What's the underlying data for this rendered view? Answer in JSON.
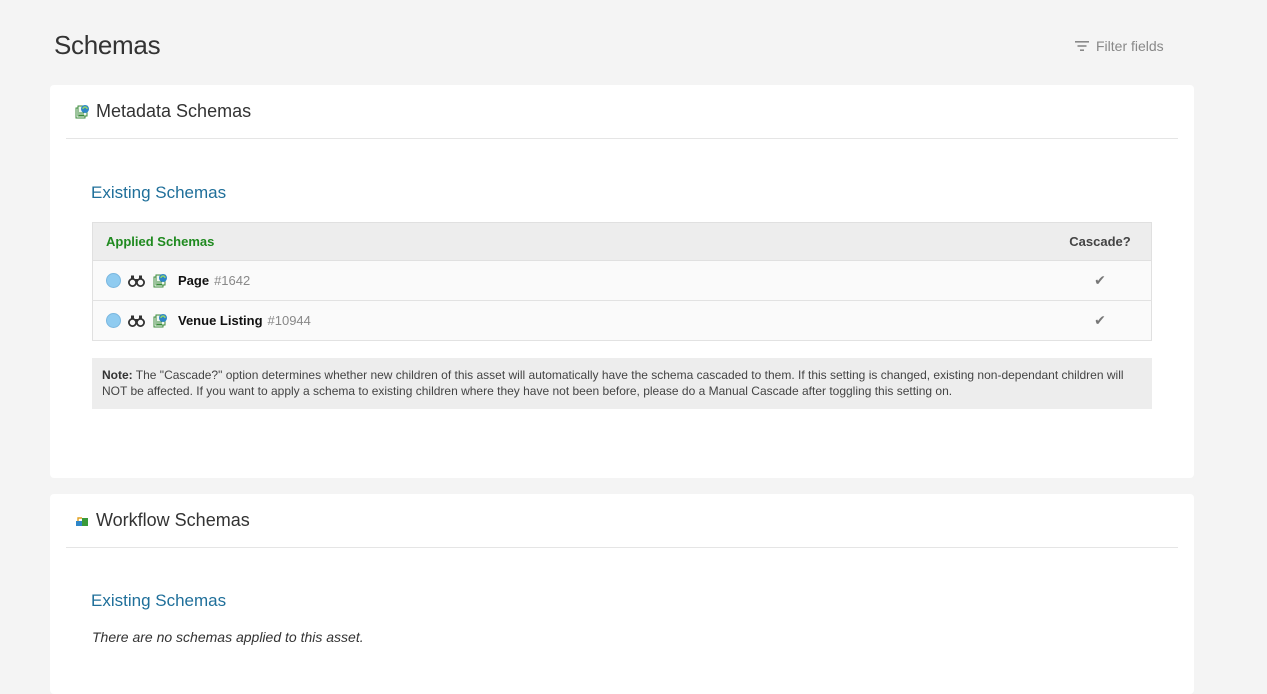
{
  "page": {
    "title": "Schemas",
    "filter_label": "Filter fields"
  },
  "metadata_card": {
    "title": "Metadata Schemas",
    "section_title": "Existing Schemas",
    "table": {
      "col_applied": "Applied Schemas",
      "col_cascade": "Cascade?",
      "rows": [
        {
          "name": "Page",
          "id": "#1642",
          "cascade": "✔"
        },
        {
          "name": "Venue Listing",
          "id": "#10944",
          "cascade": "✔"
        }
      ]
    },
    "note_label": "Note:",
    "note_text": "The \"Cascade?\" option determines whether new children of this asset will automatically have the schema cascaded to them. If this setting is changed, existing non-dependant children will NOT be affected. If you want to apply a schema to existing children where they have not been before, please do a Manual Cascade after toggling this setting on."
  },
  "workflow_card": {
    "title": "Workflow Schemas",
    "section_title": "Existing Schemas",
    "empty_message": "There are no schemas applied to this asset."
  },
  "icons": {
    "filter": "filter-icon",
    "metadata": "metadata-schema-icon",
    "workflow": "workflow-schema-icon",
    "status_dot": "status-dot-icon",
    "preview": "binoculars-icon",
    "check": "checkmark-icon"
  },
  "colors": {
    "background": "#f4f4f4",
    "section_title": "#1f6f9a",
    "applied_header": "#1f8a1f",
    "status_dot": "#8fcbf0"
  }
}
